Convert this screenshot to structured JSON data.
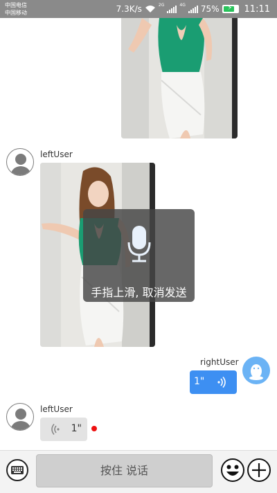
{
  "status_bar": {
    "carrier_1": "中国电信",
    "carrier_2": "中国移动",
    "net_speed": "7.3K/s",
    "signal_1_type": "2G",
    "signal_2_type": "4G",
    "battery": "75%",
    "time": "11:11"
  },
  "messages": [
    {
      "side": "left",
      "type": "image"
    },
    {
      "side": "left",
      "type": "image",
      "username": "leftUser"
    },
    {
      "side": "right",
      "type": "voice",
      "username": "rightUser",
      "duration": "1\""
    },
    {
      "side": "left",
      "type": "voice",
      "username": "leftUser",
      "duration": "1\"",
      "unread": true
    }
  ],
  "recording_overlay": {
    "icon": "microphone-icon",
    "text": "手指上滑, 取消发送"
  },
  "input_bar": {
    "keyboard_icon": "keyboard-icon",
    "hold_to_talk_label": "按住 说话",
    "emoji_icon": "smiley-icon",
    "plus_icon": "plus-icon"
  },
  "colors": {
    "status_bar": "#8a8a8a",
    "voice_bubble_right": "#3d8ff2",
    "voice_bubble_left": "#e3e3e3",
    "unread_dot": "#ee1111",
    "qq_avatar": "#6bb3f5",
    "battery_fill": "#29c35b"
  }
}
